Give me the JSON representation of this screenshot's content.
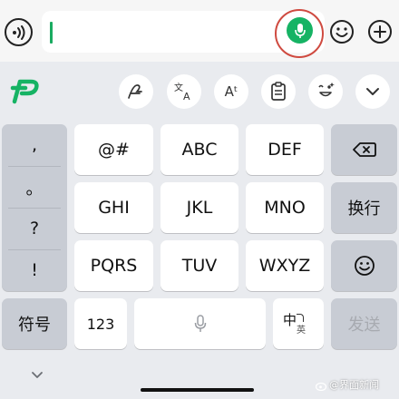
{
  "input_bar": {
    "voice_icon": "voice-toggle-icon",
    "mic_icon": "microphone-icon",
    "emoji_icon": "emoji-icon",
    "add_icon": "plus-icon"
  },
  "toolbar": {
    "logo": "keyboard-logo-icon",
    "tools": [
      {
        "icon": "handwriting-icon"
      },
      {
        "icon": "translate-icon",
        "label_a": "文",
        "label_b": "A"
      },
      {
        "icon": "font-size-icon",
        "label": "Aᵗ"
      },
      {
        "icon": "clipboard-icon"
      },
      {
        "icon": "emoticon-icon"
      },
      {
        "icon": "chevron-down-icon"
      }
    ]
  },
  "punctuation": [
    ",",
    "。",
    "?",
    "!"
  ],
  "keys": {
    "row1": [
      "@#",
      "ABC",
      "DEF"
    ],
    "row2": [
      "GHI",
      "JKL",
      "MNO"
    ],
    "row3": [
      "PQRS",
      "TUV",
      "WXYZ"
    ],
    "symbols": "符号",
    "numbers": "123",
    "space_icon": "microphone-icon",
    "lang_big": "中",
    "lang_small": "英",
    "backspace_icon": "backspace-icon",
    "newline": "换行",
    "emoji_icon": "emoji-icon",
    "send": "发送"
  },
  "footer": {
    "collapse_icon": "chevron-down-icon",
    "watermark": "@界面新闻"
  },
  "colors": {
    "accent_green": "#16b364",
    "highlight_ring": "#cf4a40",
    "keyboard_bg": "#e9ebef",
    "function_key": "#c8ccd4"
  }
}
